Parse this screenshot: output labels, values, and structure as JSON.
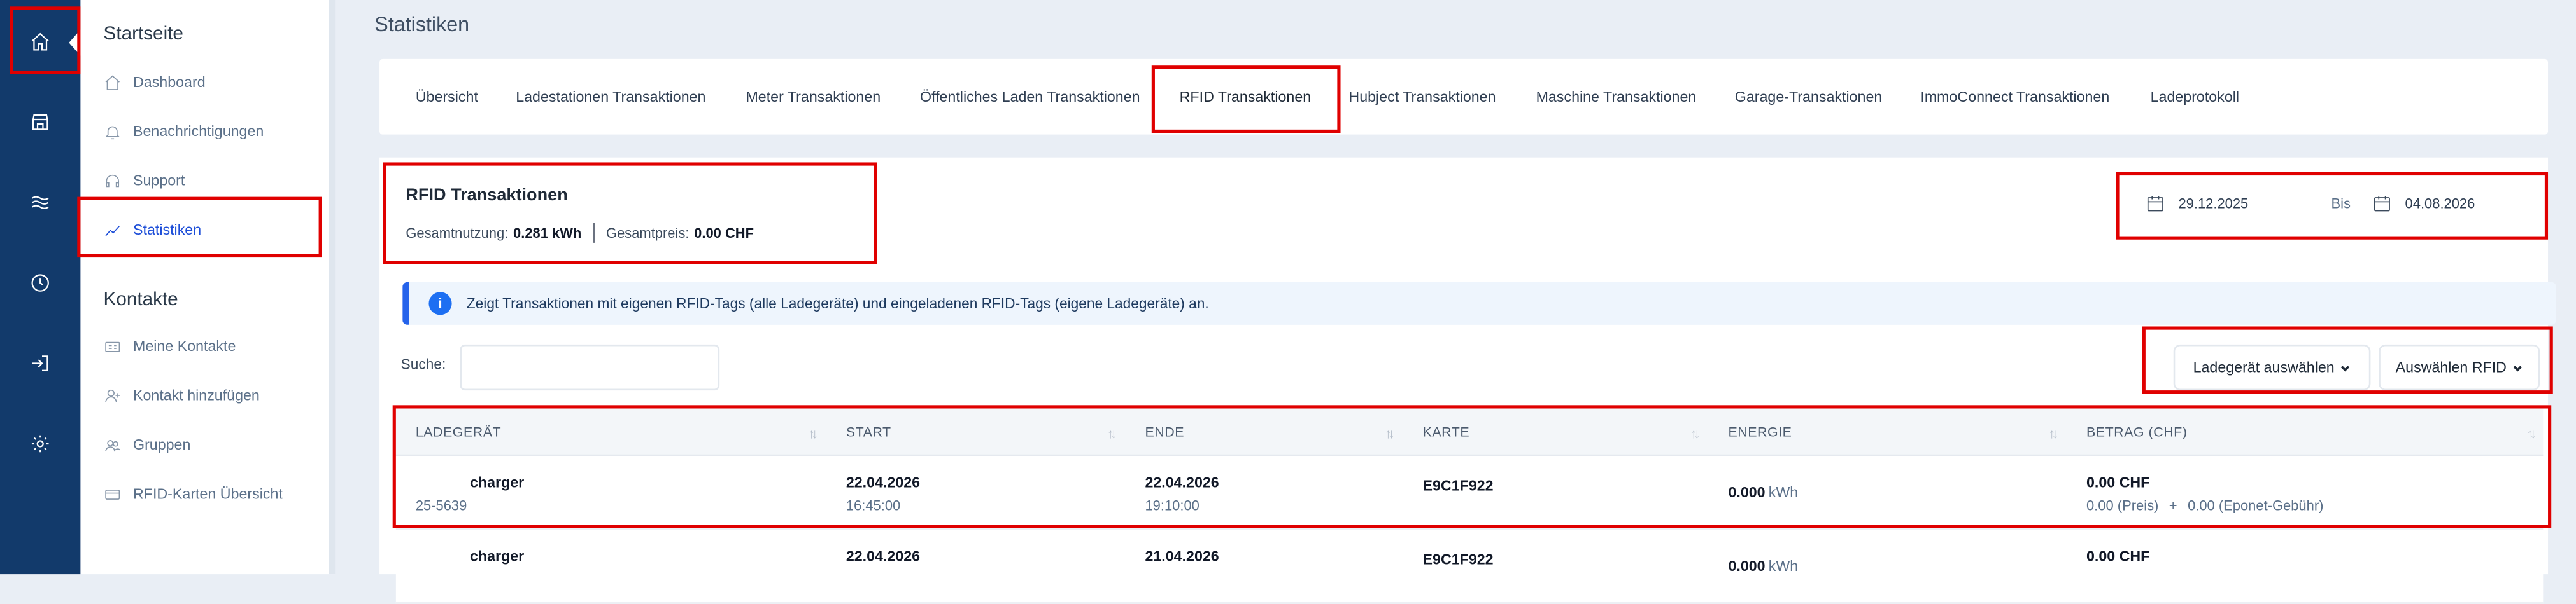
{
  "sidebar": {
    "section_start": "Startseite",
    "section_contacts": "Kontakte",
    "items_start": [
      {
        "label": "Dashboard",
        "icon": "home-icon"
      },
      {
        "label": "Benachrichtigungen",
        "icon": "bell-icon"
      },
      {
        "label": "Support",
        "icon": "headset-icon"
      },
      {
        "label": "Statistiken",
        "icon": "chart-line-icon",
        "active": true
      }
    ],
    "items_contacts": [
      {
        "label": "Meine Kontakte",
        "icon": "contact-card-icon"
      },
      {
        "label": "Kontakt hinzufügen",
        "icon": "add-user-icon"
      },
      {
        "label": "Gruppen",
        "icon": "group-icon"
      },
      {
        "label": "RFID-Karten Übersicht",
        "icon": "credit-card-icon"
      }
    ]
  },
  "rail": {
    "icons": [
      "home-icon",
      "store-icon",
      "waves-icon",
      "clock-icon",
      "login-icon",
      "gear-icon"
    ]
  },
  "page": {
    "title": "Statistiken"
  },
  "tabs": [
    "Übersicht",
    "Ladestationen Transaktionen",
    "Meter Transaktionen",
    "Öffentliches Laden Transaktionen",
    "RFID Transaktionen",
    "Hubject Transaktionen",
    "Maschine Transaktionen",
    "Garage-Transaktionen",
    "ImmoConnect Transaktionen",
    "Ladeprotokoll"
  ],
  "active_tab": "RFID Transaktionen",
  "panel": {
    "title": "RFID Transaktionen",
    "usage_label": "Gesamtnutzung:",
    "usage_value": "0.281 kWh",
    "price_label": "Gesamtpreis:",
    "price_value": "0.00 CHF",
    "date_from": "29.12.2025",
    "date_to_label": "Bis",
    "date_to": "04.08.2026",
    "info_text": "Zeigt Transaktionen mit eigenen RFID-Tags (alle Ladegeräte) und eingeladenen RFID-Tags (eigene Ladegeräte) an.",
    "search_label": "Suche:",
    "search_value": "",
    "select_charger": "Ladegerät auswählen",
    "select_rfid": "Auswählen RFID"
  },
  "table": {
    "columns": [
      "LADEGERÄT",
      "START",
      "ENDE",
      "KARTE",
      "ENERGIE",
      "BETRAG (CHF)"
    ],
    "rows": [
      {
        "charger": "charger",
        "charger_id": "25-5639",
        "start_date": "22.04.2026",
        "start_time": "16:45:00",
        "end_date": "22.04.2026",
        "end_time": "19:10:00",
        "card": "E9C1F922",
        "energy": "0.000",
        "energy_unit": "kWh",
        "amount": "0.00 CHF",
        "amount_detail_price": "0.00 (Preis)",
        "amount_plus": "+",
        "amount_detail_fee": "0.00 (Eponet-Gebühr)"
      },
      {
        "charger": "charger",
        "start_date": "22.04.2026",
        "end_date": "21.04.2026",
        "card": "E9C1F922",
        "energy": "0.000",
        "energy_unit": "kWh",
        "amount": "0.00 CHF"
      }
    ]
  },
  "colors": {
    "rail_bg": "#123a6b",
    "accent": "#1d4ed8",
    "highlight": "#e00000",
    "info_bg": "#eef5fd"
  }
}
